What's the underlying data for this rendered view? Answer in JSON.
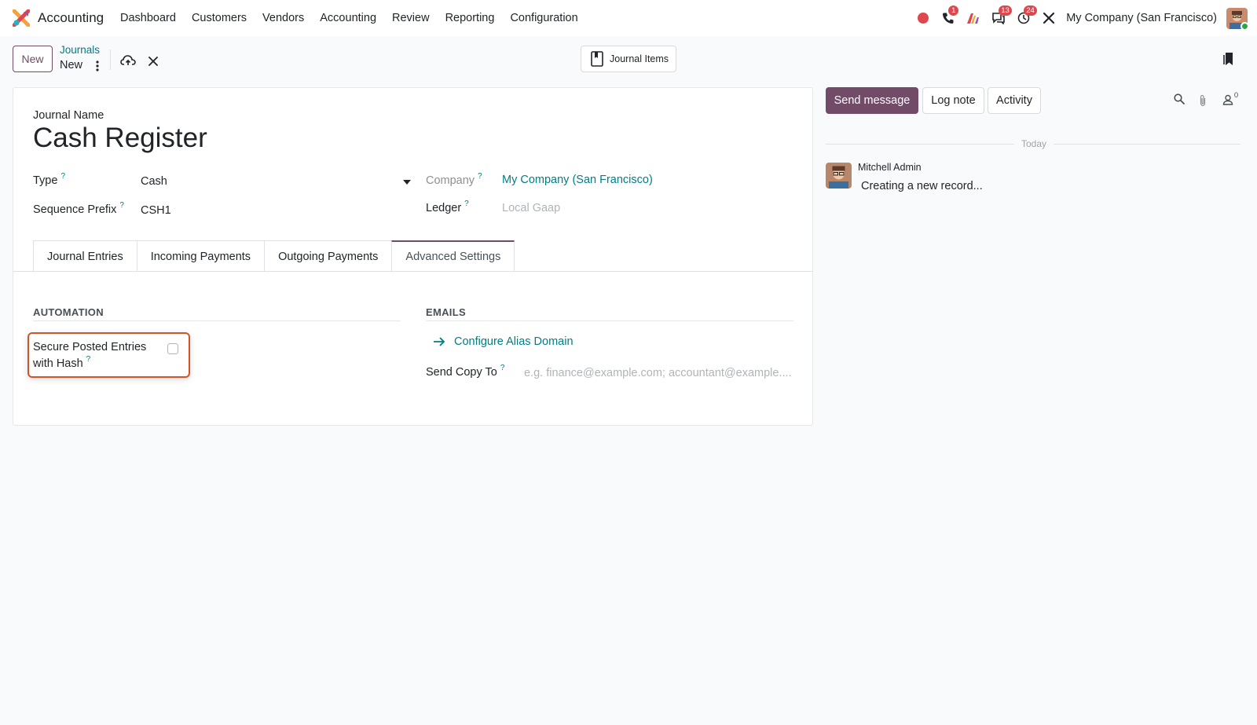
{
  "app": {
    "name": "Accounting"
  },
  "menu": [
    "Dashboard",
    "Customers",
    "Vendors",
    "Accounting",
    "Review",
    "Reporting",
    "Configuration"
  ],
  "systray": {
    "calls_badge": "1",
    "messages_badge": "13",
    "activities_badge": "24",
    "company": "My Company (San Francisco)"
  },
  "control": {
    "new_label": "New",
    "breadcrumb_parent": "Journals",
    "breadcrumb_current": "New",
    "smart_button_label": "Journal Items"
  },
  "form": {
    "journal_name_label": "Journal Name",
    "journal_name": "Cash Register",
    "type_label": "Type",
    "type_value": "Cash",
    "sequence_prefix_label": "Sequence Prefix",
    "sequence_prefix_value": "CSH1",
    "company_label": "Company",
    "company_value": "My Company (San Francisco)",
    "ledger_label": "Ledger",
    "ledger_placeholder": "Local Gaap",
    "help_mark": "?"
  },
  "tabs": [
    "Journal Entries",
    "Incoming Payments",
    "Outgoing Payments",
    "Advanced Settings"
  ],
  "active_tab": "Advanced Settings",
  "advanced": {
    "automation_title": "AUTOMATION",
    "secure_hash_label_line1": "Secure Posted Entries",
    "secure_hash_label_line2": "with Hash",
    "secure_hash_checked": false,
    "emails_title": "EMAILS",
    "configure_alias_label": "Configure Alias Domain",
    "send_copy_label": "Send Copy To",
    "send_copy_placeholder": "e.g. finance@example.com; accountant@example...."
  },
  "chatter": {
    "send_message": "Send message",
    "log_note": "Log note",
    "activity": "Activity",
    "followers_count": "0",
    "date_separator": "Today",
    "messages": [
      {
        "author": "Mitchell Admin",
        "body": "Creating a new record..."
      }
    ]
  },
  "colors": {
    "brand": "#714b67",
    "link": "#017e84",
    "highlight": "#d4542a",
    "badge": "#e0474c"
  }
}
